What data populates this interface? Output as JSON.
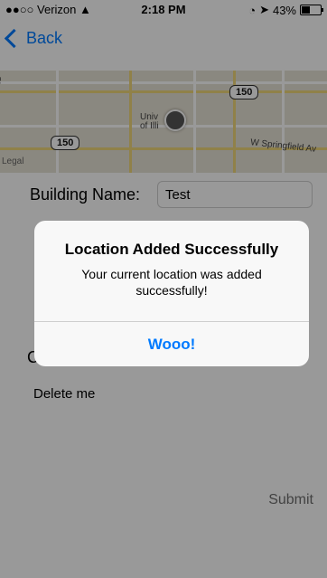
{
  "status": {
    "carrier": "●●○○ Verizon",
    "wifi_icon": "wifi-icon",
    "time": "2:18 PM",
    "lock_icon": "orientation-lock-icon",
    "location_icon": "location-arrow-icon",
    "battery": "43%",
    "battery_level": 0.43
  },
  "nav": {
    "back_label": "Back"
  },
  "map": {
    "route_label": "150",
    "route_label_2": "150",
    "university_label": "Univ\nof Illi",
    "street_label": "W Springfield Av",
    "legal": "Legal",
    "left_street": "St"
  },
  "form": {
    "building_label": "Building Name:",
    "building_value": "Test",
    "list_item": "Delete me",
    "submit_label": "Submit",
    "hidden_letter": "C"
  },
  "alert": {
    "title": "Location Added Successfully",
    "message": "Your current location was added successfully!",
    "button": "Wooo!"
  }
}
